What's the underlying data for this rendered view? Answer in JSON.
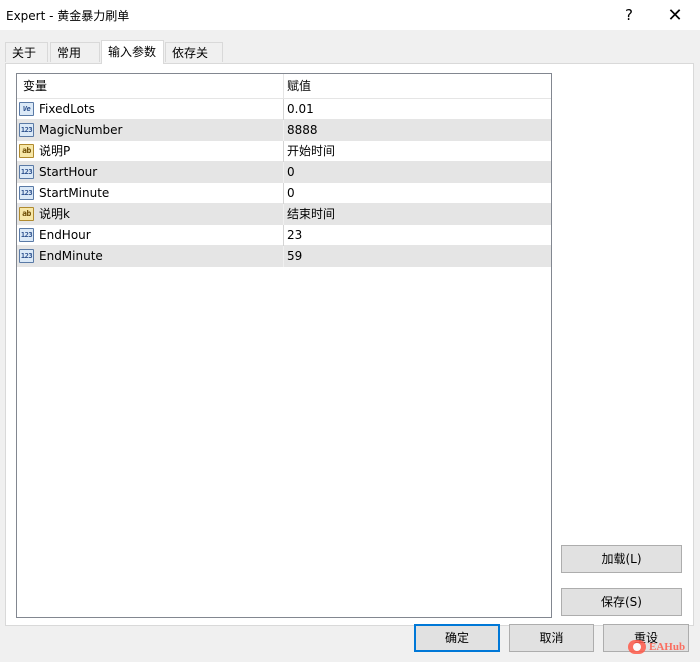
{
  "window": {
    "title": "Expert - 黄金暴力刷单",
    "help_label": "?",
    "close_label": "✕"
  },
  "tabs": [
    {
      "label": "关于",
      "active": false
    },
    {
      "label": "常用",
      "active": false
    },
    {
      "label": "输入参数",
      "active": true
    },
    {
      "label": "依存关系",
      "active": false
    }
  ],
  "grid": {
    "columns": [
      "变量",
      "赋值"
    ],
    "rows": [
      {
        "icon": "ve",
        "icon_text": "Ve",
        "name": "FixedLots",
        "value": "0.01"
      },
      {
        "icon": "123",
        "icon_text": "123",
        "name": "MagicNumber",
        "value": "8888"
      },
      {
        "icon": "ab",
        "icon_text": "ab",
        "name": "说明P",
        "value": "开始时间"
      },
      {
        "icon": "123",
        "icon_text": "123",
        "name": "StartHour",
        "value": "0"
      },
      {
        "icon": "123",
        "icon_text": "123",
        "name": "StartMinute",
        "value": "0"
      },
      {
        "icon": "ab",
        "icon_text": "ab",
        "name": "说明k",
        "value": "结束时间"
      },
      {
        "icon": "123",
        "icon_text": "123",
        "name": "EndHour",
        "value": "23"
      },
      {
        "icon": "123",
        "icon_text": "123",
        "name": "EndMinute",
        "value": "59"
      }
    ]
  },
  "buttons": {
    "load": "加载(L)",
    "save": "保存(S)",
    "ok": "确定",
    "cancel": "取消",
    "reset": "重设"
  },
  "watermark": {
    "text": "EAHub"
  }
}
